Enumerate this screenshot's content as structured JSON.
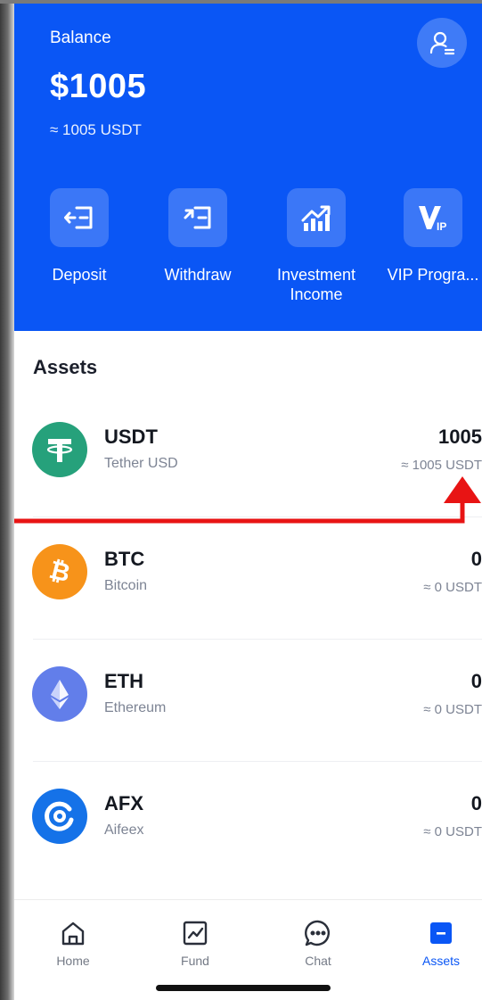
{
  "header": {
    "balance_label": "Balance",
    "balance_amount": "$1005",
    "balance_sub": "≈ 1005 USDT",
    "accent_color": "#0a56f5",
    "profile_icon": "user-profile-icon"
  },
  "actions": [
    {
      "label": "Deposit",
      "icon": "deposit-icon"
    },
    {
      "label": "Withdraw",
      "icon": "withdraw-icon"
    },
    {
      "label": "Investment\nIncome",
      "icon": "chart-up-icon"
    },
    {
      "label": "VIP Progra...",
      "icon": "vip-icon"
    }
  ],
  "assets": {
    "title": "Assets",
    "items": [
      {
        "symbol": "USDT",
        "name": "Tether USD",
        "amount": "1005",
        "approx": "≈ 1005 USDT",
        "color": "#26a17b",
        "icon": "tether-icon"
      },
      {
        "symbol": "BTC",
        "name": "Bitcoin",
        "amount": "0",
        "approx": "≈ 0 USDT",
        "color": "#f7931a",
        "icon": "bitcoin-icon"
      },
      {
        "symbol": "ETH",
        "name": "Ethereum",
        "amount": "0",
        "approx": "≈ 0 USDT",
        "color": "#627eea",
        "icon": "ethereum-icon"
      },
      {
        "symbol": "AFX",
        "name": "Aifeex",
        "amount": "0",
        "approx": "≈ 0 USDT",
        "color": "#1572e8",
        "icon": "aifeex-icon"
      }
    ]
  },
  "annotation": {
    "color": "#e81414",
    "icon": "red-arrow-annotation"
  },
  "nav": {
    "items": [
      {
        "label": "Home",
        "icon": "home-icon"
      },
      {
        "label": "Fund",
        "icon": "fund-chart-icon"
      },
      {
        "label": "Chat",
        "icon": "chat-bubble-icon"
      },
      {
        "label": "Assets",
        "icon": "assets-icon",
        "active": true
      }
    ],
    "active_color": "#0a56f5"
  }
}
